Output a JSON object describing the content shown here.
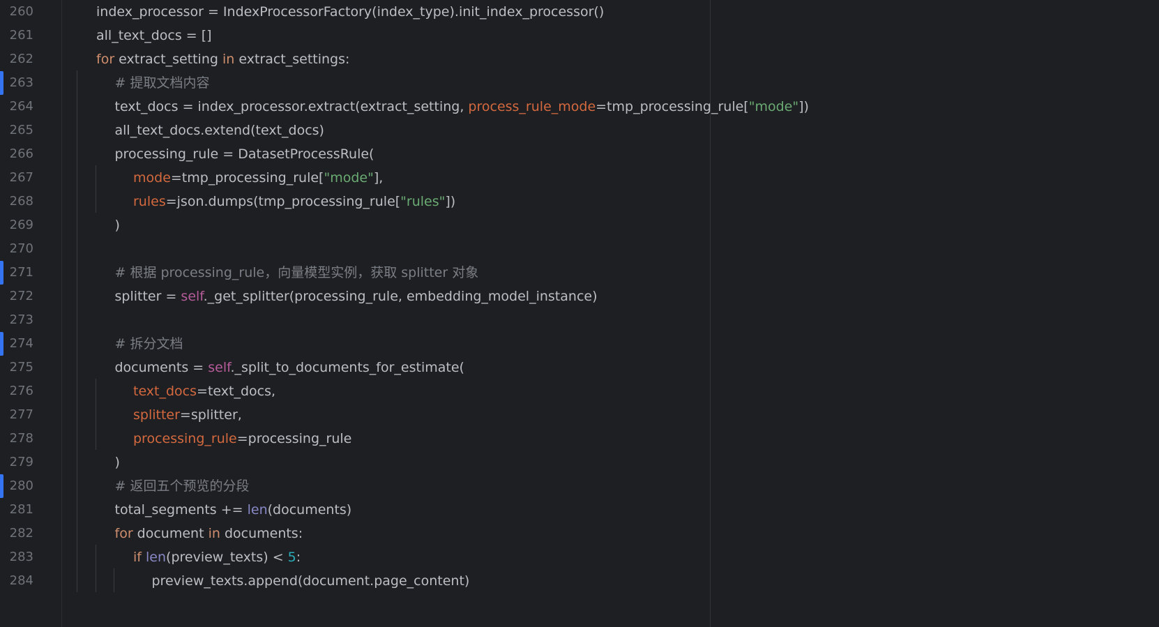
{
  "editor": {
    "language": "python",
    "colors": {
      "background": "#1e1f22",
      "line_number": "#6f737a",
      "vcs_changed": "#3574f0",
      "keyword": "#cf8e6d",
      "named_param": "#d4693f",
      "string": "#6aab73",
      "comment": "#7a7e85",
      "self": "#b55b9a",
      "builtin": "#8888c6",
      "number": "#2aacb8",
      "text": "#bcbec4"
    },
    "lines": [
      {
        "number": "260",
        "indent": 1,
        "changed": false,
        "tokens": [
          {
            "t": "index_processor = IndexProcessorFactory(index_type).init_index_processor()",
            "c": "plain"
          }
        ]
      },
      {
        "number": "261",
        "indent": 1,
        "changed": false,
        "tokens": [
          {
            "t": "all_text_docs = []",
            "c": "plain"
          }
        ]
      },
      {
        "number": "262",
        "indent": 1,
        "changed": false,
        "tokens": [
          {
            "t": "for",
            "c": "kw"
          },
          {
            "t": " extract_setting ",
            "c": "plain"
          },
          {
            "t": "in",
            "c": "kw"
          },
          {
            "t": " extract_settings:",
            "c": "plain"
          }
        ]
      },
      {
        "number": "263",
        "indent": 2,
        "changed": true,
        "tokens": [
          {
            "t": "# 提取文档内容",
            "c": "cmt"
          }
        ]
      },
      {
        "number": "264",
        "indent": 2,
        "changed": false,
        "tokens": [
          {
            "t": "text_docs = index_processor.extract(extract_setting, ",
            "c": "plain"
          },
          {
            "t": "process_rule_mode",
            "c": "param"
          },
          {
            "t": "=tmp_processing_rule[",
            "c": "plain"
          },
          {
            "t": "\"mode\"",
            "c": "str"
          },
          {
            "t": "])",
            "c": "plain"
          }
        ]
      },
      {
        "number": "265",
        "indent": 2,
        "changed": false,
        "tokens": [
          {
            "t": "all_text_docs.extend(text_docs)",
            "c": "plain"
          }
        ]
      },
      {
        "number": "266",
        "indent": 2,
        "changed": false,
        "tokens": [
          {
            "t": "processing_rule = DatasetProcessRule(",
            "c": "plain"
          }
        ]
      },
      {
        "number": "267",
        "indent": 3,
        "changed": false,
        "tokens": [
          {
            "t": "mode",
            "c": "param"
          },
          {
            "t": "=tmp_processing_rule[",
            "c": "plain"
          },
          {
            "t": "\"mode\"",
            "c": "str"
          },
          {
            "t": "],",
            "c": "plain"
          }
        ]
      },
      {
        "number": "268",
        "indent": 3,
        "changed": false,
        "tokens": [
          {
            "t": "rules",
            "c": "param"
          },
          {
            "t": "=json.dumps(tmp_processing_rule[",
            "c": "plain"
          },
          {
            "t": "\"rules\"",
            "c": "str"
          },
          {
            "t": "])",
            "c": "plain"
          }
        ]
      },
      {
        "number": "269",
        "indent": 2,
        "changed": false,
        "tokens": [
          {
            "t": ")",
            "c": "plain"
          }
        ]
      },
      {
        "number": "270",
        "indent": 2,
        "changed": false,
        "tokens": []
      },
      {
        "number": "271",
        "indent": 2,
        "changed": true,
        "tokens": [
          {
            "t": "# 根据 processing_rule，向量模型实例，获取 splitter 对象",
            "c": "cmt"
          }
        ]
      },
      {
        "number": "272",
        "indent": 2,
        "changed": false,
        "tokens": [
          {
            "t": "splitter = ",
            "c": "plain"
          },
          {
            "t": "self",
            "c": "self"
          },
          {
            "t": "._get_splitter(processing_rule, embedding_model_instance)",
            "c": "plain"
          }
        ]
      },
      {
        "number": "273",
        "indent": 2,
        "changed": false,
        "tokens": []
      },
      {
        "number": "274",
        "indent": 2,
        "changed": true,
        "tokens": [
          {
            "t": "# 拆分文档",
            "c": "cmt"
          }
        ]
      },
      {
        "number": "275",
        "indent": 2,
        "changed": false,
        "tokens": [
          {
            "t": "documents = ",
            "c": "plain"
          },
          {
            "t": "self",
            "c": "self"
          },
          {
            "t": "._split_to_documents_for_estimate(",
            "c": "plain"
          }
        ]
      },
      {
        "number": "276",
        "indent": 3,
        "changed": false,
        "tokens": [
          {
            "t": "text_docs",
            "c": "param"
          },
          {
            "t": "=text_docs,",
            "c": "plain"
          }
        ]
      },
      {
        "number": "277",
        "indent": 3,
        "changed": false,
        "tokens": [
          {
            "t": "splitter",
            "c": "param"
          },
          {
            "t": "=splitter,",
            "c": "plain"
          }
        ]
      },
      {
        "number": "278",
        "indent": 3,
        "changed": false,
        "tokens": [
          {
            "t": "processing_rule",
            "c": "param"
          },
          {
            "t": "=processing_rule",
            "c": "plain"
          }
        ]
      },
      {
        "number": "279",
        "indent": 2,
        "changed": false,
        "tokens": [
          {
            "t": ")",
            "c": "plain"
          }
        ]
      },
      {
        "number": "280",
        "indent": 2,
        "changed": true,
        "tokens": [
          {
            "t": "# 返回五个预览的分段",
            "c": "cmt"
          }
        ]
      },
      {
        "number": "281",
        "indent": 2,
        "changed": false,
        "tokens": [
          {
            "t": "total_segments += ",
            "c": "plain"
          },
          {
            "t": "len",
            "c": "builtin"
          },
          {
            "t": "(documents)",
            "c": "plain"
          }
        ]
      },
      {
        "number": "282",
        "indent": 2,
        "changed": false,
        "tokens": [
          {
            "t": "for",
            "c": "kw"
          },
          {
            "t": " document ",
            "c": "plain"
          },
          {
            "t": "in",
            "c": "kw"
          },
          {
            "t": " documents:",
            "c": "plain"
          }
        ]
      },
      {
        "number": "283",
        "indent": 3,
        "changed": false,
        "tokens": [
          {
            "t": "if",
            "c": "kw"
          },
          {
            "t": " ",
            "c": "plain"
          },
          {
            "t": "len",
            "c": "builtin"
          },
          {
            "t": "(preview_texts) < ",
            "c": "plain"
          },
          {
            "t": "5",
            "c": "num"
          },
          {
            "t": ":",
            "c": "plain"
          }
        ]
      },
      {
        "number": "284",
        "indent": 4,
        "changed": false,
        "tokens": [
          {
            "t": "preview_texts.append(document.page_content)",
            "c": "plain"
          }
        ]
      }
    ]
  }
}
